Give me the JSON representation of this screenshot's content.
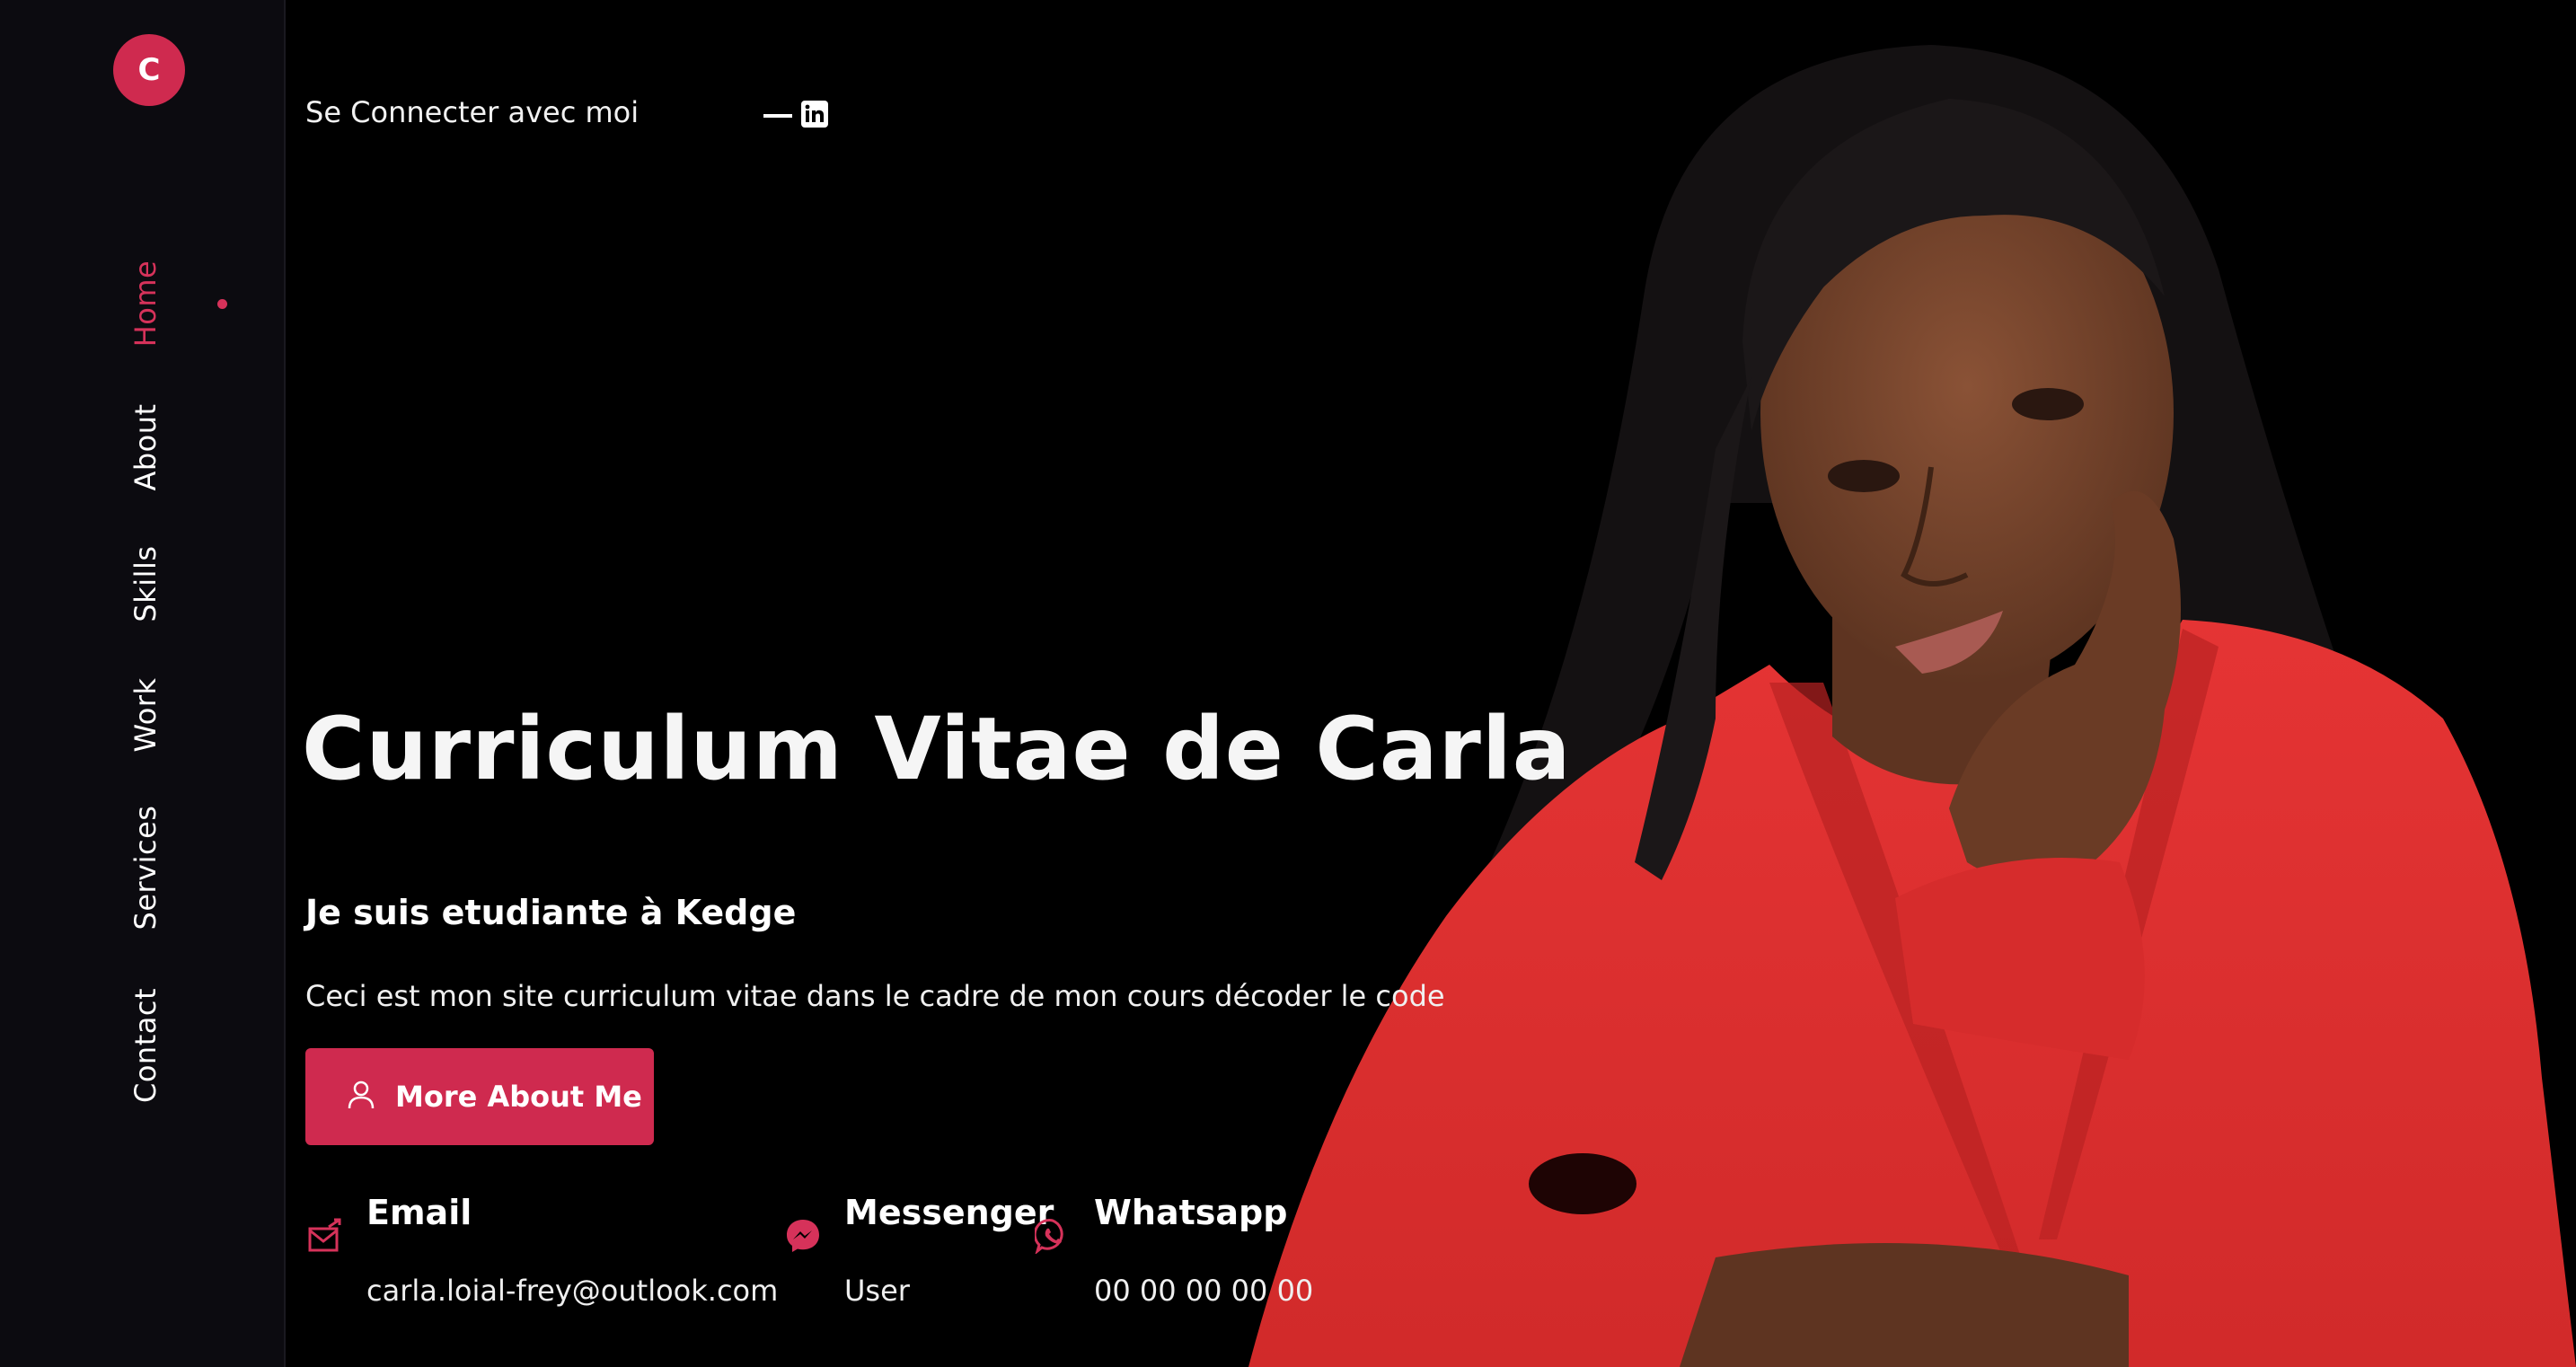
{
  "sidebar": {
    "logo_letter": "C",
    "items": [
      {
        "label": "Home",
        "active": true
      },
      {
        "label": "About",
        "active": false
      },
      {
        "label": "Skills",
        "active": false
      },
      {
        "label": "Work",
        "active": false
      },
      {
        "label": "Services",
        "active": false
      },
      {
        "label": "Contact",
        "active": false
      }
    ]
  },
  "header": {
    "connect_label": "Se Connecter avec moi",
    "social_icon": "linkedin-icon"
  },
  "hero": {
    "title": "Curriculum Vitae de Carla",
    "subtitle": "Je suis etudiante à Kedge",
    "description": "Ceci est mon site curriculum vitae dans le cadre de mon cours décoder le code",
    "cta_label": "More About Me",
    "cta_icon": "user-icon"
  },
  "contacts": [
    {
      "title": "Email",
      "value": "carla.loial-frey@outlook.com",
      "icon": "mail-icon"
    },
    {
      "title": "Messenger",
      "value": "User",
      "icon": "messenger-icon"
    },
    {
      "title": "Whatsapp",
      "value": "00 00 00 00 00",
      "icon": "whatsapp-icon"
    }
  ],
  "colors": {
    "accent": "#cf2a4f",
    "background": "#000000",
    "sidebar": "#0c0b10",
    "shirt": "#e12b2e"
  }
}
